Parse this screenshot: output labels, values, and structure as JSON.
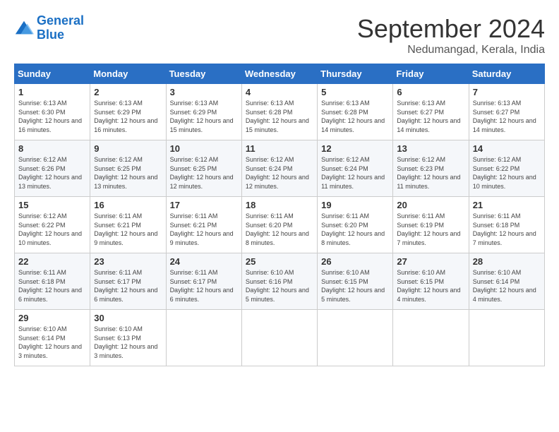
{
  "logo": {
    "line1": "General",
    "line2": "Blue"
  },
  "title": "September 2024",
  "subtitle": "Nedumangad, Kerala, India",
  "days_of_week": [
    "Sunday",
    "Monday",
    "Tuesday",
    "Wednesday",
    "Thursday",
    "Friday",
    "Saturday"
  ],
  "weeks": [
    [
      {
        "day": "1",
        "sunrise": "6:13 AM",
        "sunset": "6:30 PM",
        "daylight": "12 hours and 16 minutes."
      },
      {
        "day": "2",
        "sunrise": "6:13 AM",
        "sunset": "6:29 PM",
        "daylight": "12 hours and 16 minutes."
      },
      {
        "day": "3",
        "sunrise": "6:13 AM",
        "sunset": "6:29 PM",
        "daylight": "12 hours and 15 minutes."
      },
      {
        "day": "4",
        "sunrise": "6:13 AM",
        "sunset": "6:28 PM",
        "daylight": "12 hours and 15 minutes."
      },
      {
        "day": "5",
        "sunrise": "6:13 AM",
        "sunset": "6:28 PM",
        "daylight": "12 hours and 14 minutes."
      },
      {
        "day": "6",
        "sunrise": "6:13 AM",
        "sunset": "6:27 PM",
        "daylight": "12 hours and 14 minutes."
      },
      {
        "day": "7",
        "sunrise": "6:13 AM",
        "sunset": "6:27 PM",
        "daylight": "12 hours and 14 minutes."
      }
    ],
    [
      {
        "day": "8",
        "sunrise": "6:12 AM",
        "sunset": "6:26 PM",
        "daylight": "12 hours and 13 minutes."
      },
      {
        "day": "9",
        "sunrise": "6:12 AM",
        "sunset": "6:25 PM",
        "daylight": "12 hours and 13 minutes."
      },
      {
        "day": "10",
        "sunrise": "6:12 AM",
        "sunset": "6:25 PM",
        "daylight": "12 hours and 12 minutes."
      },
      {
        "day": "11",
        "sunrise": "6:12 AM",
        "sunset": "6:24 PM",
        "daylight": "12 hours and 12 minutes."
      },
      {
        "day": "12",
        "sunrise": "6:12 AM",
        "sunset": "6:24 PM",
        "daylight": "12 hours and 11 minutes."
      },
      {
        "day": "13",
        "sunrise": "6:12 AM",
        "sunset": "6:23 PM",
        "daylight": "12 hours and 11 minutes."
      },
      {
        "day": "14",
        "sunrise": "6:12 AM",
        "sunset": "6:22 PM",
        "daylight": "12 hours and 10 minutes."
      }
    ],
    [
      {
        "day": "15",
        "sunrise": "6:12 AM",
        "sunset": "6:22 PM",
        "daylight": "12 hours and 10 minutes."
      },
      {
        "day": "16",
        "sunrise": "6:11 AM",
        "sunset": "6:21 PM",
        "daylight": "12 hours and 9 minutes."
      },
      {
        "day": "17",
        "sunrise": "6:11 AM",
        "sunset": "6:21 PM",
        "daylight": "12 hours and 9 minutes."
      },
      {
        "day": "18",
        "sunrise": "6:11 AM",
        "sunset": "6:20 PM",
        "daylight": "12 hours and 8 minutes."
      },
      {
        "day": "19",
        "sunrise": "6:11 AM",
        "sunset": "6:20 PM",
        "daylight": "12 hours and 8 minutes."
      },
      {
        "day": "20",
        "sunrise": "6:11 AM",
        "sunset": "6:19 PM",
        "daylight": "12 hours and 7 minutes."
      },
      {
        "day": "21",
        "sunrise": "6:11 AM",
        "sunset": "6:18 PM",
        "daylight": "12 hours and 7 minutes."
      }
    ],
    [
      {
        "day": "22",
        "sunrise": "6:11 AM",
        "sunset": "6:18 PM",
        "daylight": "12 hours and 6 minutes."
      },
      {
        "day": "23",
        "sunrise": "6:11 AM",
        "sunset": "6:17 PM",
        "daylight": "12 hours and 6 minutes."
      },
      {
        "day": "24",
        "sunrise": "6:11 AM",
        "sunset": "6:17 PM",
        "daylight": "12 hours and 6 minutes."
      },
      {
        "day": "25",
        "sunrise": "6:10 AM",
        "sunset": "6:16 PM",
        "daylight": "12 hours and 5 minutes."
      },
      {
        "day": "26",
        "sunrise": "6:10 AM",
        "sunset": "6:15 PM",
        "daylight": "12 hours and 5 minutes."
      },
      {
        "day": "27",
        "sunrise": "6:10 AM",
        "sunset": "6:15 PM",
        "daylight": "12 hours and 4 minutes."
      },
      {
        "day": "28",
        "sunrise": "6:10 AM",
        "sunset": "6:14 PM",
        "daylight": "12 hours and 4 minutes."
      }
    ],
    [
      {
        "day": "29",
        "sunrise": "6:10 AM",
        "sunset": "6:14 PM",
        "daylight": "12 hours and 3 minutes."
      },
      {
        "day": "30",
        "sunrise": "6:10 AM",
        "sunset": "6:13 PM",
        "daylight": "12 hours and 3 minutes."
      },
      null,
      null,
      null,
      null,
      null
    ]
  ]
}
